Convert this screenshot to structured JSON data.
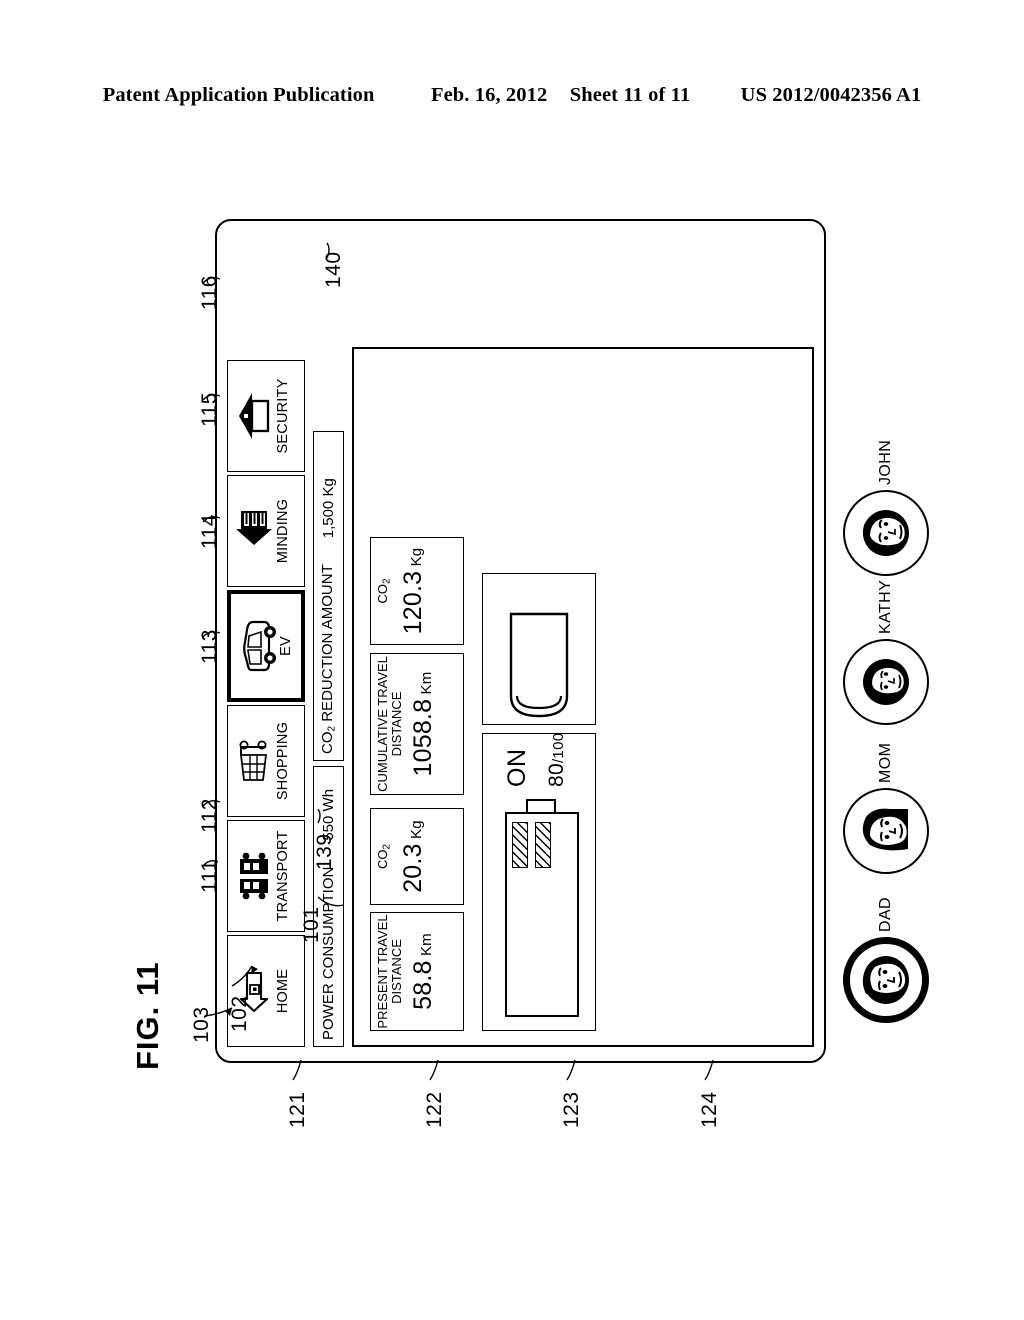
{
  "publication_header": {
    "left": "Patent Application Publication",
    "date": "Feb. 16, 2012",
    "sheet": "Sheet 11 of 11",
    "number": "US 2012/0042356 A1"
  },
  "figure": {
    "label": "FIG. 11"
  },
  "icon_bar": {
    "items": [
      {
        "icon": "home-icon",
        "label": "HOME",
        "ref": "111",
        "selected": false
      },
      {
        "icon": "bus-icon",
        "label": "TRANSPORT",
        "ref": "112",
        "selected": false
      },
      {
        "icon": "cart-icon",
        "label": "SHOPPING",
        "ref": "113",
        "selected": false
      },
      {
        "icon": "car-icon",
        "label": "EV",
        "ref": "114",
        "selected": true
      },
      {
        "icon": "minding-icon",
        "label": "MINDING",
        "ref": "115",
        "selected": false
      },
      {
        "icon": "security-icon",
        "label": "SECURITY",
        "ref": "116",
        "selected": false
      }
    ]
  },
  "strips": [
    {
      "ref": "139",
      "name": "power-consumption-strip",
      "label": "POWER CONSUMPTION",
      "value": "550 Wh"
    },
    {
      "ref": "140",
      "name": "co2-reduction-strip",
      "label_pre": "CO",
      "label_sub": "2",
      "label_post": " REDUCTION AMOUNT",
      "value": "1,500 Kg"
    }
  ],
  "screen": {
    "ref": "101",
    "data_boxes": [
      {
        "name": "present-travel-distance",
        "title": "PRESENT TRAVEL\nDISTANCE",
        "value": "58.8",
        "unit": "Km"
      },
      {
        "name": "co2-present",
        "title_pre": "CO",
        "title_sub": "2",
        "value": "20.3",
        "unit": "Kg"
      },
      {
        "name": "cumulative-travel-distance",
        "title": "CUMULATIVE TRAVEL\nDISTANCE",
        "value": "1058.8",
        "unit": "Km"
      },
      {
        "name": "co2-cumulative",
        "title_pre": "CO",
        "title_sub": "2",
        "value": "120.3",
        "unit": "Kg"
      }
    ],
    "battery": {
      "state": "ON",
      "level_value": "80",
      "level_den": "/100"
    }
  },
  "avatars": {
    "ref_selection_arrow": "102",
    "ref_row": "103",
    "items": [
      {
        "name": "DAD",
        "ref": "121",
        "selected": true
      },
      {
        "name": "MOM",
        "ref": "122",
        "selected": false
      },
      {
        "name": "KATHY",
        "ref": "123",
        "selected": false
      },
      {
        "name": "JOHN",
        "ref": "124",
        "selected": false
      }
    ]
  }
}
